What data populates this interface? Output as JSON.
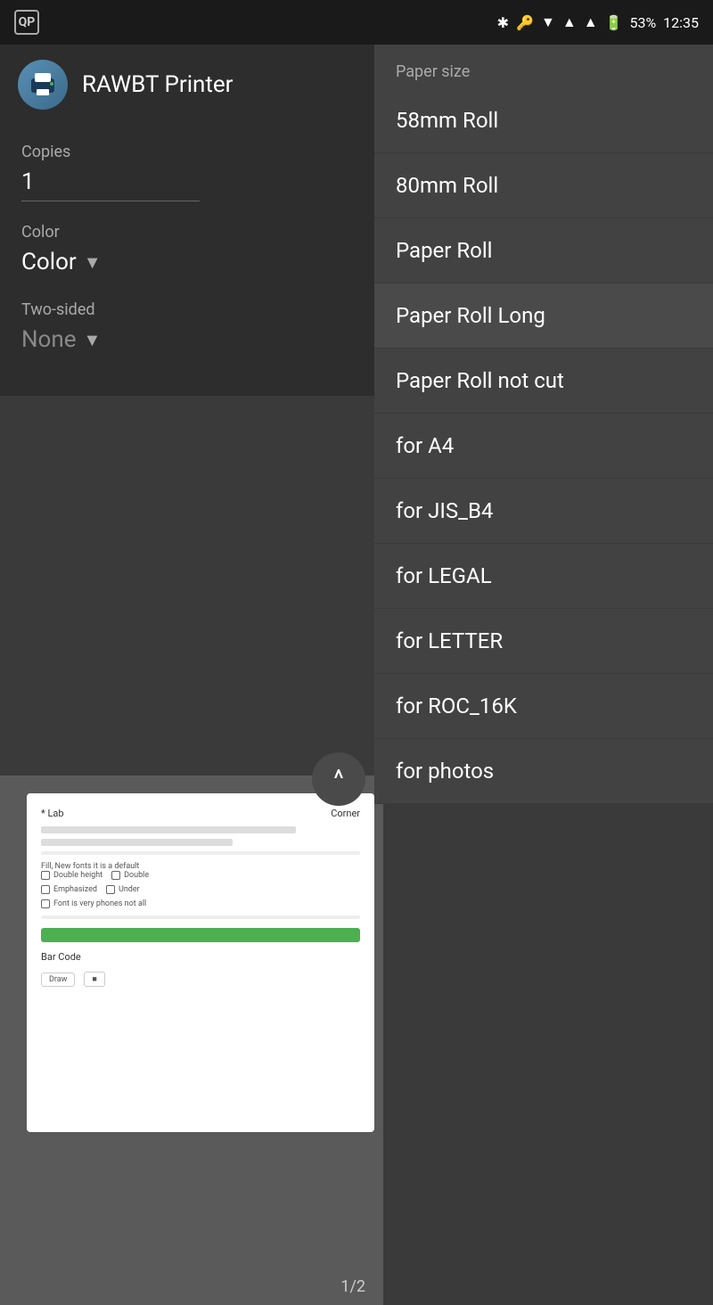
{
  "statusBar": {
    "appIcon": "QP",
    "bluetooth": "⚡",
    "time": "12:35",
    "battery": "53%"
  },
  "header": {
    "printerName": "RAWBT Printer",
    "dropdownArrow": "▼"
  },
  "printOptions": {
    "copiesLabel": "Copies",
    "copiesValue": "1",
    "colorLabel": "Color",
    "colorValue": "Color",
    "twoSidedLabel": "Two-sided",
    "twoSidedValue": "None",
    "paperSizeLabel": "Paper size"
  },
  "paperSizeItems": [
    {
      "id": "58mm",
      "label": "58mm Roll"
    },
    {
      "id": "80mm",
      "label": "80mm Roll"
    },
    {
      "id": "roll",
      "label": "Paper Roll"
    },
    {
      "id": "roll-long",
      "label": "Paper Roll Long"
    },
    {
      "id": "roll-no-cut",
      "label": "Paper Roll not cut"
    },
    {
      "id": "a4",
      "label": "for A4"
    },
    {
      "id": "jis-b4",
      "label": "for JIS_B4"
    },
    {
      "id": "legal",
      "label": "for LEGAL"
    },
    {
      "id": "letter",
      "label": "for LETTER"
    },
    {
      "id": "roc16k",
      "label": "for ROC_16K"
    },
    {
      "id": "photos",
      "label": "for photos"
    }
  ],
  "collapseButton": {
    "icon": "^"
  },
  "preview": {
    "pageIndicator": "1/2",
    "headerLeft": "* Lab",
    "headerRight": "Corner"
  }
}
